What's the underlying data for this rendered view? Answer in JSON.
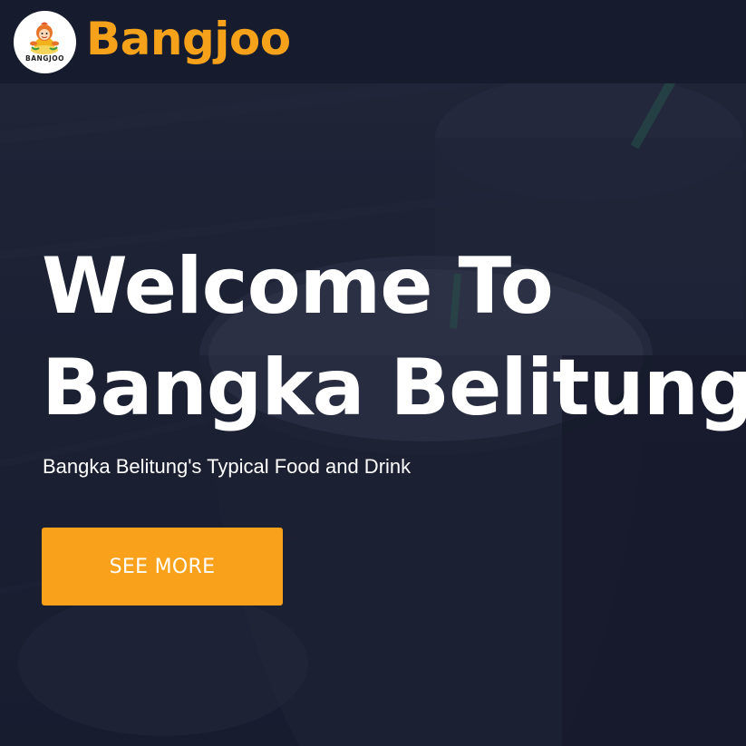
{
  "navbar": {
    "logo_text": "BANGJOO",
    "brand": "Bangjoo"
  },
  "hero": {
    "title_line1": "Welcome To",
    "title_line2": "Bangka Belitung",
    "subtitle": "Bangka Belitung's Typical Food and Drink",
    "cta_label": "SEE MORE"
  },
  "colors": {
    "accent": "#f9a11b",
    "navbar_bg": "#161c2e",
    "hero_bg": "#20263a",
    "text": "#ffffff"
  },
  "icons": {
    "logo": "mascot-logo",
    "background": "drink-cups-photo"
  }
}
